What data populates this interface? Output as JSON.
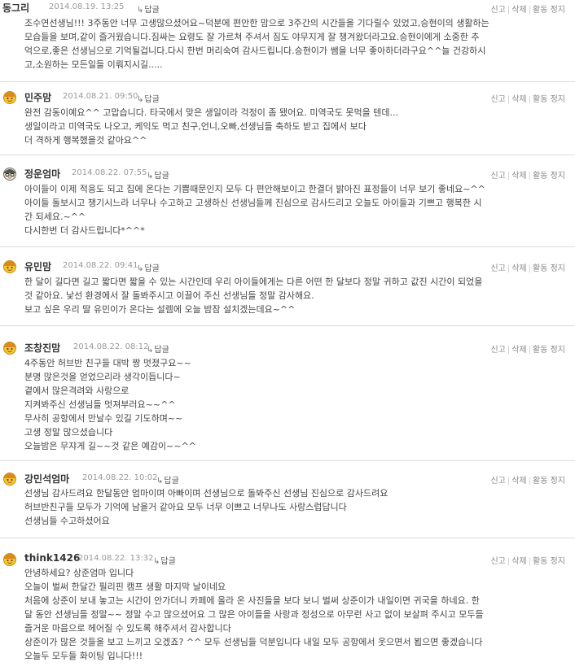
{
  "reply_label": "답글",
  "actions": {
    "report": "신고",
    "delete": "삭제",
    "suspend": "활동 정지"
  },
  "comments": [
    {
      "nick": "동그리",
      "date": "2014.08.19. 13:25",
      "lines": [
        "조수연선생님!!! 3주동안 너무 고생많으셨어요~덕분에 편안한 맘으로 3주간의 시간들을 기다릴수 있었고,승현이의 생활하는",
        "모습들을 보며,같이 즐거웠습니다.짐싸는 요령도 잘 가르쳐 주셔서 짐도 야무지게 잘 챙겨왔더라고요.승현이에게 소중한 추",
        "억으로,좋은 선생님으로 기억될겁니다.다시 한번 머리숙여 감사드립니다.승현이가 쌤을 너무 좋아하더라구요^^늘 건강하시",
        "고,소원하는 모든일들 이뤄지시길....."
      ]
    },
    {
      "nick": "민주맘",
      "date": "2014.08.21. 09:50",
      "lines": [
        "완전 감동이예요^^ 고맙습니다. 타국에서 맞은 생일이라 걱정이 좀 됐어요. 미역국도 못먹을 텐데...",
        "생일이라고 미역국도 나오고, 케익도 먹고 친구,언니,오빠,선생님들 축하도 받고 집에서 보다",
        "더 격하게 행복했을것 같아요^^"
      ]
    },
    {
      "nick": "정운엄마",
      "date": "2014.08.22. 07:55",
      "lines": [
        "아이들이 이제 적응도 되고 집에 온다는 기쁨때문인지 모두 다 편안해보이고 한결더 밝아진 표정들이 너무 보기 좋네요~^^",
        "아이들 돌보시고 챙기시느라 너무나 수고하고 고생하신 선생님들께 진심으로 감사드리고 오늘도 아이들과 기쁘고 행복한 시",
        "간 되세요.~^^",
        "다시한번 더 감사드립니다*^^*"
      ]
    },
    {
      "nick": "유민맘",
      "date": "2014.08.22. 09:41",
      "lines": [
        "한 달이 길다면 길고 짧다면 짧을 수 있는 시간인데 우리 아이들에게는 다른 어떤 한 달보다 정말 귀하고 값진 시간이 되었을",
        "것 같아요. 낯선 환경에서 잘 돌봐주시고 이끌어 주신 선생님들 정말 감사해요.",
        "보고 싶은 우리 딸 유민이가 온다는 설렘에 오늘 밤잠 설치겠는데요~^^"
      ]
    },
    {
      "nick": "조창진맘",
      "date": "2014.08.22. 08:12",
      "lines": [
        "4주동안 허브반 친구들 대박 짱 멋졌구요~~",
        "분명 많은것을 얻었으리라 생각이듭니다~",
        "곁에서 많은격려와 사랑으로",
        "지켜봐주신 선생님들 멋져부러요~~^^",
        "무사히 공항에서 만날수 있길 기도하며~~",
        "고생 정말 많으셨습니다",
        "오늘밤은 무쟈게 길~~것 같은 예감이~~^^"
      ]
    },
    {
      "nick": "강민석엄마",
      "date": "2014.08.22. 10:02",
      "lines": [
        "선생님 감사드려요 한달동안 엄마이며 아빠이며 선생님으로 돌봐주신 선생님 진심으로 감사드려요",
        "허브반친구들 모두가 기억에 남을거 같아요 모두 너무 이쁘고 너무나도 사랑스럽답니다",
        "선생님들 수고하셨어요"
      ]
    },
    {
      "nick": "think1426",
      "date": "2014.08.22. 13:32",
      "lines": [
        "안녕하세요? 상준엄마 입니다",
        "오늘이 벌써 한달간 필리핀 캠프 생활 마지막 날이네요",
        "처음에 상준이 보내 놓고는 시간이 안가더니 카페에 올라 온 사진들을 보다 보니 벌써 상준이가 내일이면 귀국을 하네요. 한",
        "달 동안 선생님들 정말~~ 정말 수고 많으셨어요 그 많은 아이들을 사랑과 정성으로 아무런 사고 없이 보살펴 주시고 모두들",
        "즐거운 마음으로 헤어질 수 있도록 해주셔서 감사합니다",
        "상준이가 많은 것들을 보고 느끼고 오겠죠? ^^ 모두 선생님들 덕분입니다 내일 모두 공항에서 웃으면서 뵙으면 좋겠습니다",
        "오늘두 모두들 화이팅 입니다!!!"
      ]
    }
  ]
}
